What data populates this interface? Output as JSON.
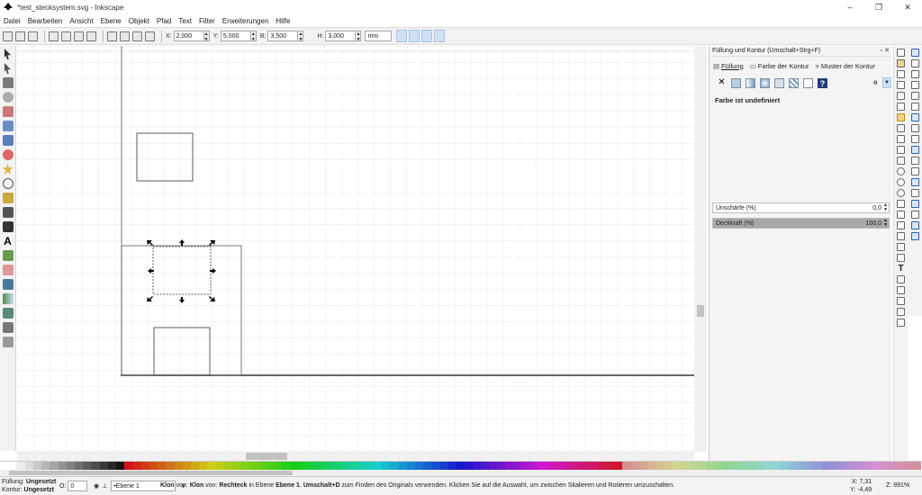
{
  "window": {
    "title": "*test_stecksystem.svg - Inkscape",
    "controls": [
      "–",
      "❐",
      "✕"
    ]
  },
  "menu": [
    "Datei",
    "Bearbeiten",
    "Ansicht",
    "Ebene",
    "Objekt",
    "Pfad",
    "Text",
    "Filter",
    "Erweiterungen",
    "Hilfe"
  ],
  "toolcontrols": {
    "x_label": "X:",
    "x_value": "2,000",
    "y_label": "Y:",
    "y_value": "5,000",
    "w_label": "B:",
    "w_value": "3,500",
    "h_label": "H:",
    "h_value": "3,000",
    "unit": "mm"
  },
  "dock": {
    "title": "Füllung und Kontur (Umschalt+Strg+F)",
    "tabs": [
      "Füllung",
      "Farbe der Kontur",
      "Muster der Kontur"
    ],
    "paint_unset_symbol": "?",
    "paint_none_symbol": "✕",
    "status": "Farbe ist undefiniert",
    "blur_label": "Unschärfe (%)",
    "blur_value": "0,0",
    "opacity_label": "Deckkraft (%)",
    "opacity_value": "100,0"
  },
  "statusbar": {
    "fill_label": "Füllung:",
    "fill_value": "Ungesetzt",
    "stroke_label": "Kontur:",
    "stroke_value": "Ungesetzt",
    "opacity_label": "O:",
    "opacity_value": "0",
    "layer": "•Ebene 1",
    "msg_clone1": "Klon",
    "msg_von1": "von:",
    "msg_clone2": "Klon",
    "msg_von2": "von:",
    "msg_rect": "Rechteck",
    "msg_in_layer": "in Ebene",
    "msg_layer": "Ebene 1",
    "msg_shortcut": "Umschalt+D",
    "msg_rest": "zum Finden des Originals verwenden. Klicken Sie auf die Auswahl, um zwischen Skalieren und Rotieren umzuschalten.",
    "coord_x_label": "X:",
    "coord_x": "7,31",
    "coord_y_label": "Y:",
    "coord_y": "-4,49",
    "zoom_label": "Z:",
    "zoom": "891%"
  },
  "colors": {
    "accent": "#2860b5",
    "selection_handle": "#000000",
    "grid": "#e3e3e3"
  }
}
